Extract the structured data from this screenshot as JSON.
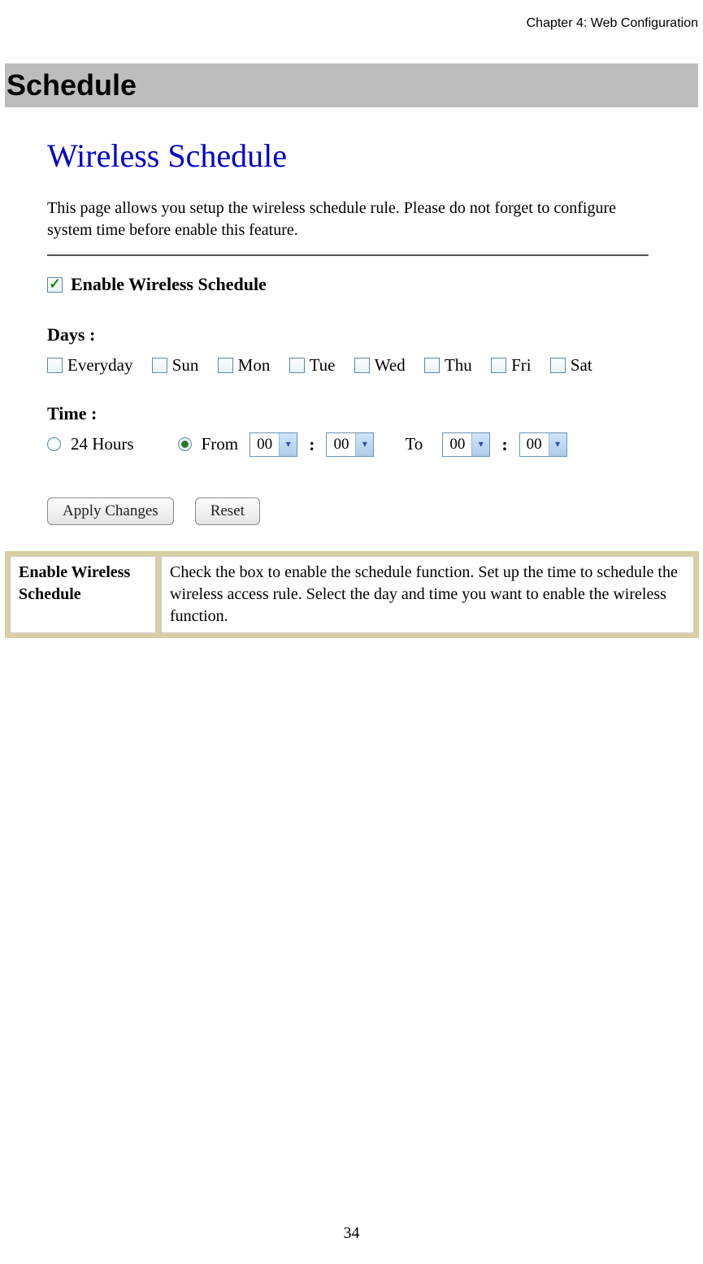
{
  "header": {
    "chapter": "Chapter 4: Web Configuration"
  },
  "section": {
    "title": "Schedule"
  },
  "screenshot": {
    "title": "Wireless Schedule",
    "intro": "This page allows you setup the wireless schedule rule. Please do not forget to configure system time before enable this feature.",
    "enable_label": "Enable Wireless Schedule",
    "days_label": "Days :",
    "days": [
      "Everyday",
      "Sun",
      "Mon",
      "Tue",
      "Wed",
      "Thu",
      "Fri",
      "Sat"
    ],
    "time_label": "Time :",
    "time_24h": "24 Hours",
    "time_from": "From",
    "time_to": "To",
    "from_h": "00",
    "from_m": "00",
    "to_h": "00",
    "to_m": "00",
    "apply_btn": "Apply Changes",
    "reset_btn": "Reset"
  },
  "desc": {
    "term": "Enable Wireless Schedule",
    "text": "Check the box to enable the schedule function. Set up the time to schedule the wireless access rule. Select the day and time you want to enable the wireless function."
  },
  "page_number": "34"
}
